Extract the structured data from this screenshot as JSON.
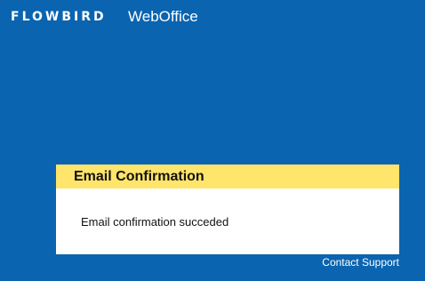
{
  "header": {
    "brand": "FLOWBIRD",
    "app_name": "WebOffice"
  },
  "dialog": {
    "title": "Email Confirmation",
    "message": "Email confirmation succeded"
  },
  "footer": {
    "support_link": "Contact Support"
  },
  "colors": {
    "background": "#0a64b0",
    "dialog_header": "#ffe56b",
    "dialog_body": "#ffffff"
  }
}
